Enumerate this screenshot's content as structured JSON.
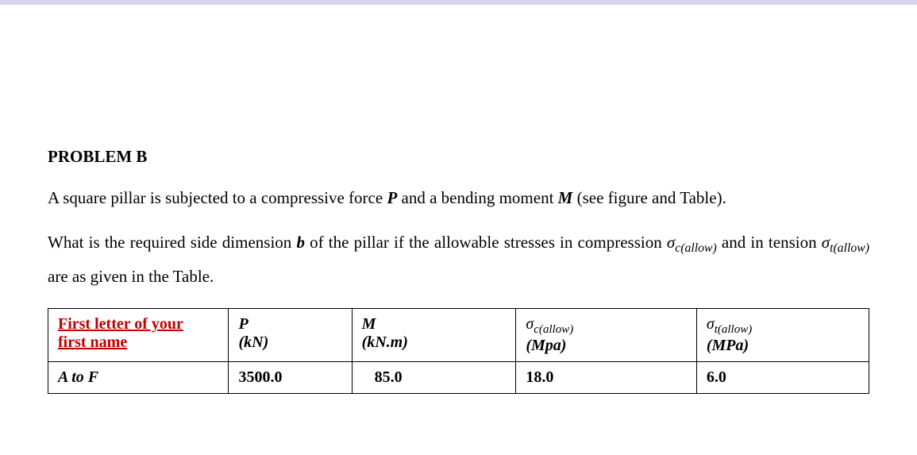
{
  "title": "PROBLEM B",
  "paragraph1_parts": {
    "p1": "A square pillar is subjected to a compressive force ",
    "P": "P",
    "p2": " and a bending moment ",
    "M": "M",
    "p3": " (see figure and Table)."
  },
  "paragraph2_parts": {
    "p1": "What is the required side dimension ",
    "b": "b",
    "p2": " of the pillar if the allowable stresses in compression ",
    "sigma_c": "σ",
    "sub_c": "c(allow)",
    "p3": " and in tension ",
    "sigma_t": "σ",
    "sub_t": "t(allow)",
    "p4": " are as given in the Table."
  },
  "table": {
    "headers": {
      "firstletter_line1": "First letter of your",
      "firstletter_line2": "first name",
      "P": "P",
      "P_unit": "(kN)",
      "M": "M",
      "M_unit": "(kN.m)",
      "sigma_c": "σ",
      "sigma_c_sub": "c(allow)",
      "sigma_c_unit": "(Mpa)",
      "sigma_t": "σ",
      "sigma_t_sub": "t(allow)",
      "sigma_t_unit": "(MPa)"
    },
    "rows": [
      {
        "letter": "A to F",
        "P": "3500.0",
        "M": "85.0",
        "sigma_c": "18.0",
        "sigma_t": "6.0"
      }
    ]
  }
}
